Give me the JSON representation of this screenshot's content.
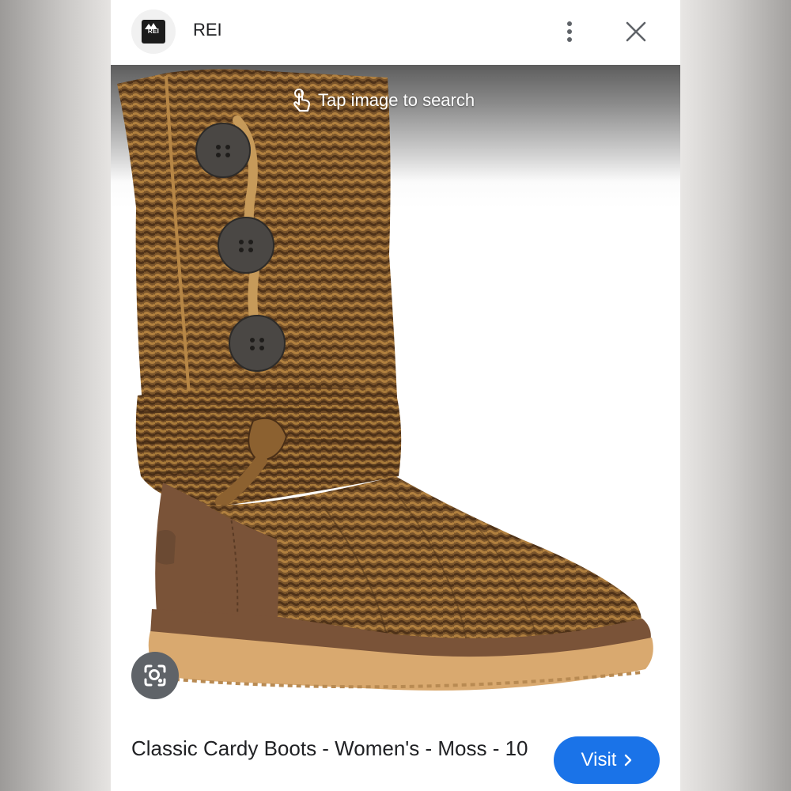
{
  "header": {
    "logo_text": "REI",
    "site_name": "REI"
  },
  "image": {
    "hint": "Tap image to search",
    "hint_icon": "hand-pointer-icon",
    "lens_icon": "lens-icon"
  },
  "result": {
    "title": "Classic Cardy Boots - Women's - Moss - 10",
    "visit_label": "Visit"
  },
  "colors": {
    "accent": "#1a73e8",
    "knit": "#8a6131",
    "suede": "#7a5338",
    "sole": "#d9a96f"
  }
}
